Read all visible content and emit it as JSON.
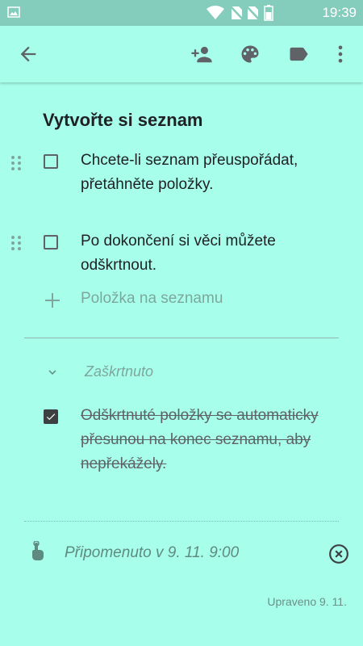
{
  "status_bar": {
    "time": "19:39",
    "icons": [
      "gallery-icon",
      "wifi-icon",
      "no-sim-icon",
      "no-sim-icon",
      "battery-icon"
    ]
  },
  "toolbar": {
    "back_icon": "arrow-back-icon",
    "actions": [
      "add-collaborator-icon",
      "palette-icon",
      "label-icon",
      "more-vert-icon"
    ]
  },
  "note": {
    "title": "Vytvořte si seznam",
    "items": [
      {
        "text": "Chcete-li seznam přeuspořádat, přetáhněte položky.",
        "checked": false
      },
      {
        "text": "Po dokončení si věci můžete odškrtnout.",
        "checked": false
      }
    ],
    "add_item_placeholder": "Položka na seznamu",
    "checked_section_label": "Zaškrtnuto",
    "checked_items": [
      {
        "text": "Odškrtnuté položky se automaticky přesunou na konec seznamu, aby nepřekážely.",
        "checked": true
      }
    ]
  },
  "reminder": {
    "text": "Připomenuto v 9. 11. 9:00"
  },
  "footer": {
    "edited": "Upraveno 9. 11."
  },
  "colors": {
    "note_background": "#a7ffeb",
    "status_bar": "#84ccbc",
    "icon": "#5f6368"
  }
}
